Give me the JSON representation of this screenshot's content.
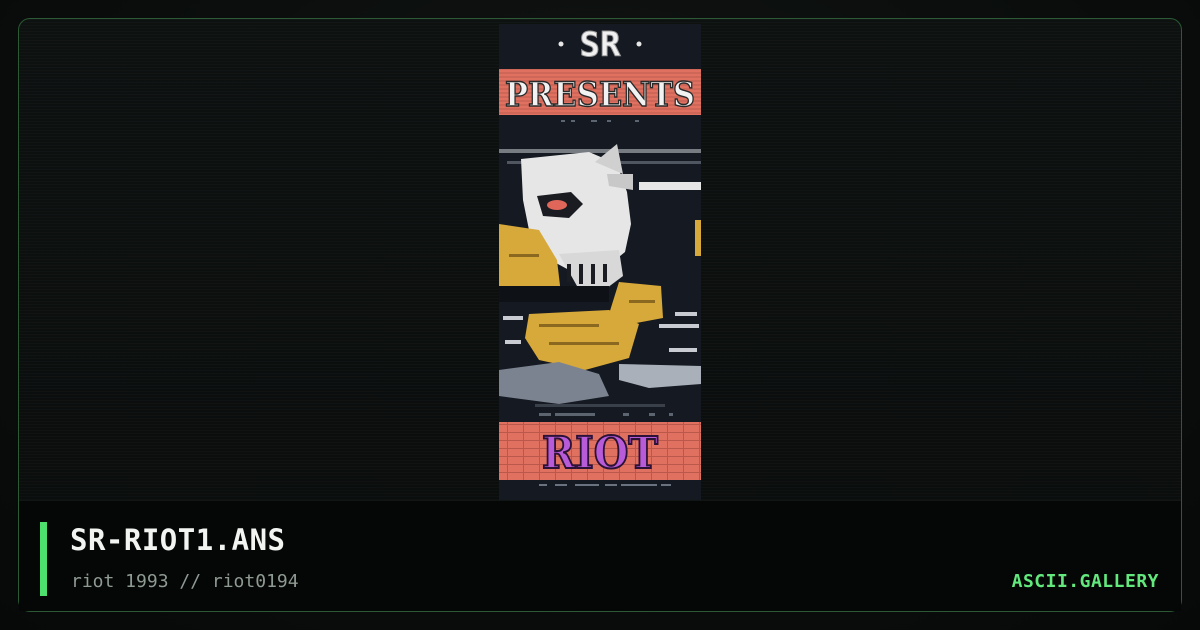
{
  "artwork": {
    "group_tag": "SR",
    "headline": "PRESENTS",
    "logo_text": "RIOT",
    "colors": {
      "background": "#151a22",
      "banner_red": "#e07060",
      "skull_white": "#e6e6e6",
      "gold": "#d7a83a",
      "logo_purple": "#b85bd8",
      "accent_green": "#4ee06d"
    }
  },
  "info": {
    "filename": "SR-RIOT1.ANS",
    "meta": "riot 1993 // riot0194",
    "brand": "ASCII.GALLERY"
  }
}
